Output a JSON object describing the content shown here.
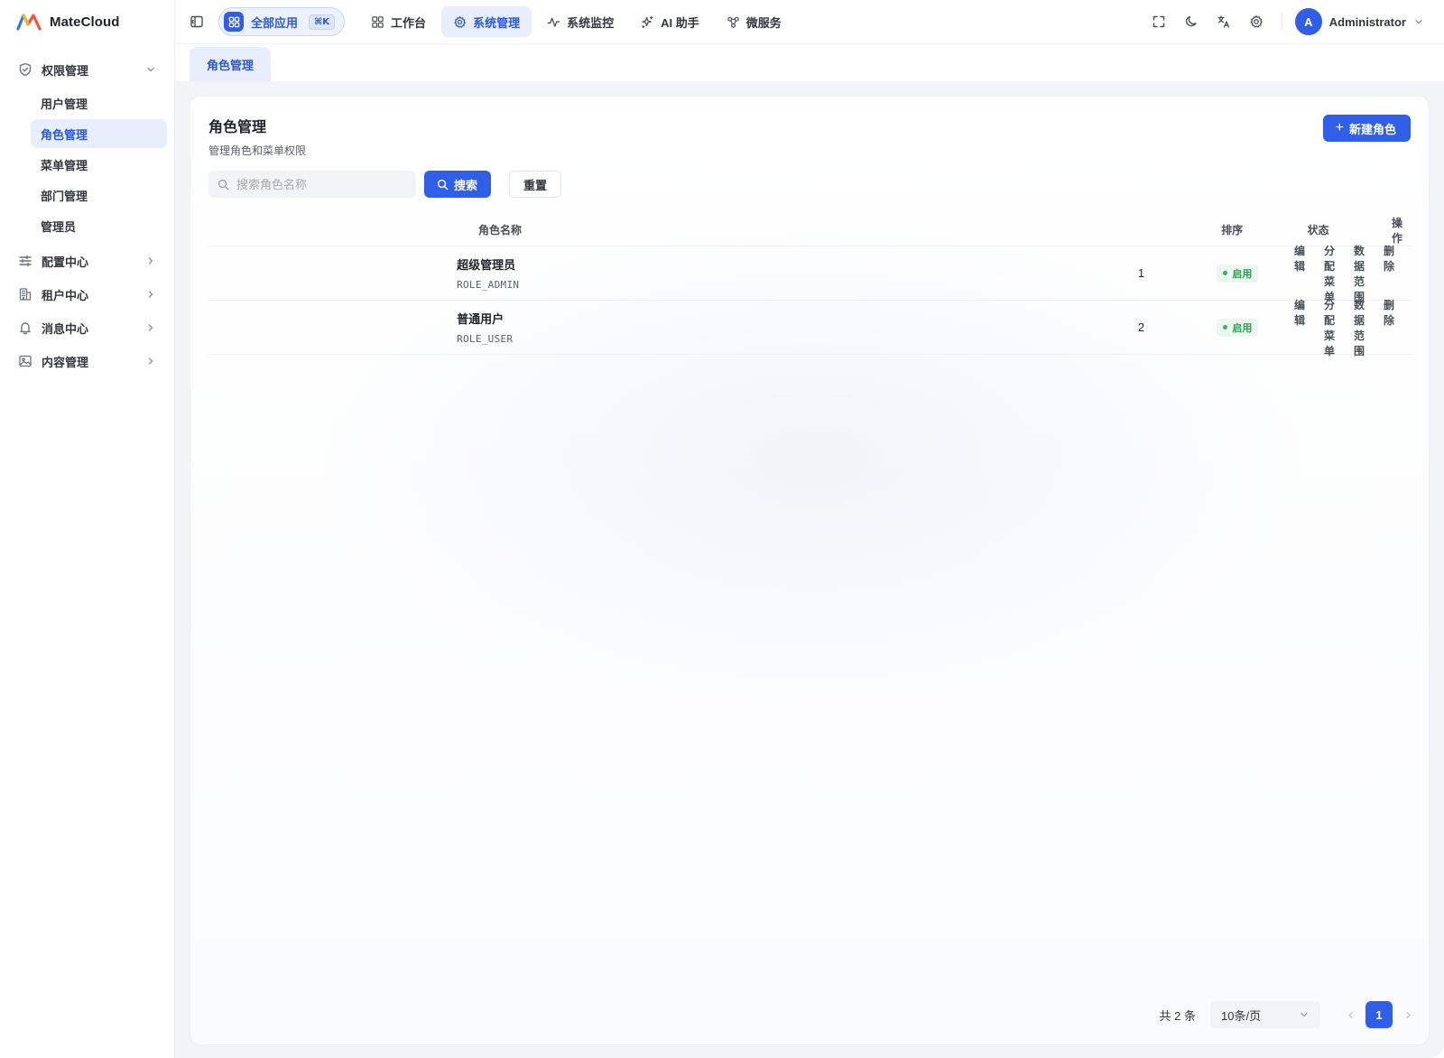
{
  "brand": {
    "name": "MateCloud"
  },
  "sidebar": {
    "groups": [
      {
        "label": "权限管理",
        "icon": "shield-icon",
        "expanded": true,
        "items": [
          {
            "label": "用户管理",
            "active": false
          },
          {
            "label": "角色管理",
            "active": true
          },
          {
            "label": "菜单管理",
            "active": false
          },
          {
            "label": "部门管理",
            "active": false
          },
          {
            "label": "管理员",
            "active": false
          }
        ]
      },
      {
        "label": "配置中心",
        "icon": "sliders-icon",
        "expanded": false
      },
      {
        "label": "租户中心",
        "icon": "building-icon",
        "expanded": false
      },
      {
        "label": "消息中心",
        "icon": "bell-icon",
        "expanded": false
      },
      {
        "label": "内容管理",
        "icon": "image-icon",
        "expanded": false
      }
    ]
  },
  "topbar": {
    "all_apps_label": "全部应用",
    "all_apps_shortcut": "⌘K",
    "tabs": [
      {
        "label": "工作台",
        "icon": "grid-icon",
        "active": false
      },
      {
        "label": "系统管理",
        "icon": "gear-icon",
        "active": true
      },
      {
        "label": "系统监控",
        "icon": "activity-icon",
        "active": false
      },
      {
        "label": "AI 助手",
        "icon": "sparkle-icon",
        "active": false
      },
      {
        "label": "微服务",
        "icon": "network-icon",
        "active": false
      }
    ],
    "user": {
      "avatar_letter": "A",
      "name": "Administrator"
    }
  },
  "tabstrip": {
    "active_tab": "角色管理"
  },
  "card": {
    "title": "角色管理",
    "subtitle": "管理角色和菜单权限",
    "new_button_label": "新建角色",
    "search": {
      "placeholder": "搜索角色名称",
      "value": "",
      "button_label": "搜索"
    },
    "reset_label": "重置"
  },
  "table": {
    "columns": {
      "name": "角色名称",
      "sort": "排序",
      "status": "状态",
      "ops": "操作"
    },
    "rows": [
      {
        "name": "超级管理员",
        "code": "ROLE_ADMIN",
        "sort": "1",
        "status": "启用"
      },
      {
        "name": "普通用户",
        "code": "ROLE_USER",
        "sort": "2",
        "status": "启用"
      }
    ],
    "row_actions": [
      "编辑",
      "分配菜单",
      "数据范围",
      "删除"
    ]
  },
  "pagination": {
    "total_text": "共 2 条",
    "page_size": "10条/页",
    "current_page": "1"
  },
  "colors": {
    "accent": "#2f5fe8",
    "accent_soft": "#e8eefc",
    "status_enabled": "#2f9e4f"
  }
}
